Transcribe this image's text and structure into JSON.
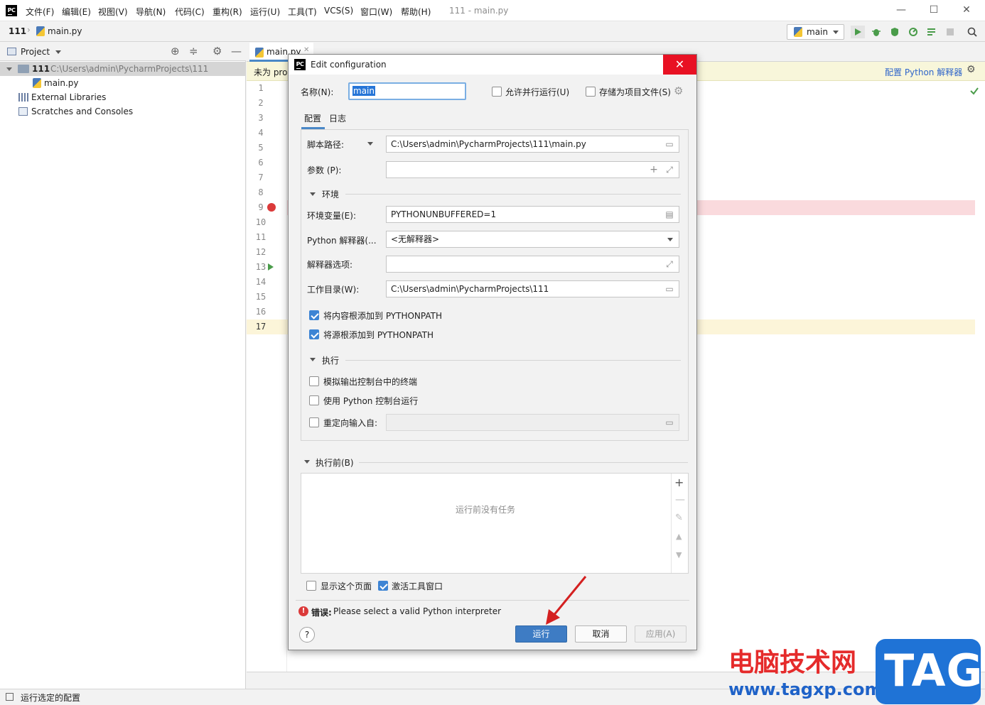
{
  "window": {
    "title": "111 - main.py",
    "menu": [
      "文件(F)",
      "编辑(E)",
      "视图(V)",
      "导航(N)",
      "代码(C)",
      "重构(R)",
      "运行(U)",
      "工具(T)",
      "VCS(S)",
      "窗口(W)",
      "帮助(H)"
    ],
    "controls": {
      "minimize": "—",
      "maximize": "☐",
      "close": "✕"
    }
  },
  "navbar": {
    "breadcrumb_project": "111",
    "breadcrumb_file": "main.py",
    "run_config": "main",
    "search_icon": "search-icon"
  },
  "project_panel": {
    "header": "Project",
    "root_name": "111",
    "root_path": "C:\\Users\\admin\\PycharmProjects\\111",
    "file": "main.py",
    "external_libs": "External Libraries",
    "scratches": "Scratches and Consoles"
  },
  "editor": {
    "tab": "main.py",
    "banner_left": "未为 pro",
    "banner_right": "配置 Python 解释器",
    "line_numbers": [
      "1",
      "2",
      "3",
      "4",
      "5",
      "6",
      "7",
      "8",
      "9",
      "10",
      "11",
      "12",
      "13",
      "14",
      "15",
      "16",
      "17"
    ],
    "colors": {
      "breakpoint_line": "#fadadd",
      "current_line": "#fcf5d9",
      "accent": "#3e7cc4",
      "error": "#db3a3a"
    }
  },
  "dialog": {
    "title": "Edit configuration",
    "name_label": "名称(N):",
    "name_value": "main",
    "allow_parallel": "允许并行运行(U)",
    "store_as_project": "存储为项目文件(S)",
    "tabs": [
      "配置",
      "日志"
    ],
    "script_path_label": "脚本路径:",
    "script_path_value": "C:\\Users\\admin\\PycharmProjects\\111\\main.py",
    "params_label": "参数 (P):",
    "params_value": "",
    "env_section": "环境",
    "env_vars_label": "环境变量(E):",
    "env_vars_value": "PYTHONUNBUFFERED=1",
    "interpreter_label": "Python 解释器(...",
    "interpreter_value": "<无解释器>",
    "interpreter_options_label": "解释器选项:",
    "interpreter_options_value": "",
    "workdir_label": "工作目录(W):",
    "workdir_value": "C:\\Users\\admin\\PycharmProjects\\111",
    "add_content_roots": "将内容根添加到 PYTHONPATH",
    "add_source_roots": "将源根添加到 PYTHONPATH",
    "exec_section": "执行",
    "emulate_terminal": "模拟输出控制台中的终端",
    "use_python_console": "使用 Python 控制台运行",
    "redirect_input": "重定向输入自:",
    "before_launch": "执行前(B)",
    "no_tasks": "运行前没有任务",
    "show_page": "显示这个页面",
    "activate_tool_window": "激活工具窗口",
    "error_prefix": "错误:",
    "error_message": "Please select a valid Python interpreter",
    "run_button": "运行",
    "cancel_button": "取消",
    "apply_button": "应用(A)",
    "help": "?",
    "checkboxes": {
      "allow_parallel": false,
      "store_as_project": false,
      "add_content_roots": true,
      "add_source_roots": true,
      "emulate_terminal": false,
      "use_python_console": false,
      "redirect_input": false,
      "show_page": false,
      "activate_tool_window": true
    }
  },
  "statusbar": {
    "text": "运行选定的配置"
  },
  "watermark": {
    "site_name": "电脑技术网",
    "url": "www.tagxp.com",
    "logo": "TAG"
  }
}
